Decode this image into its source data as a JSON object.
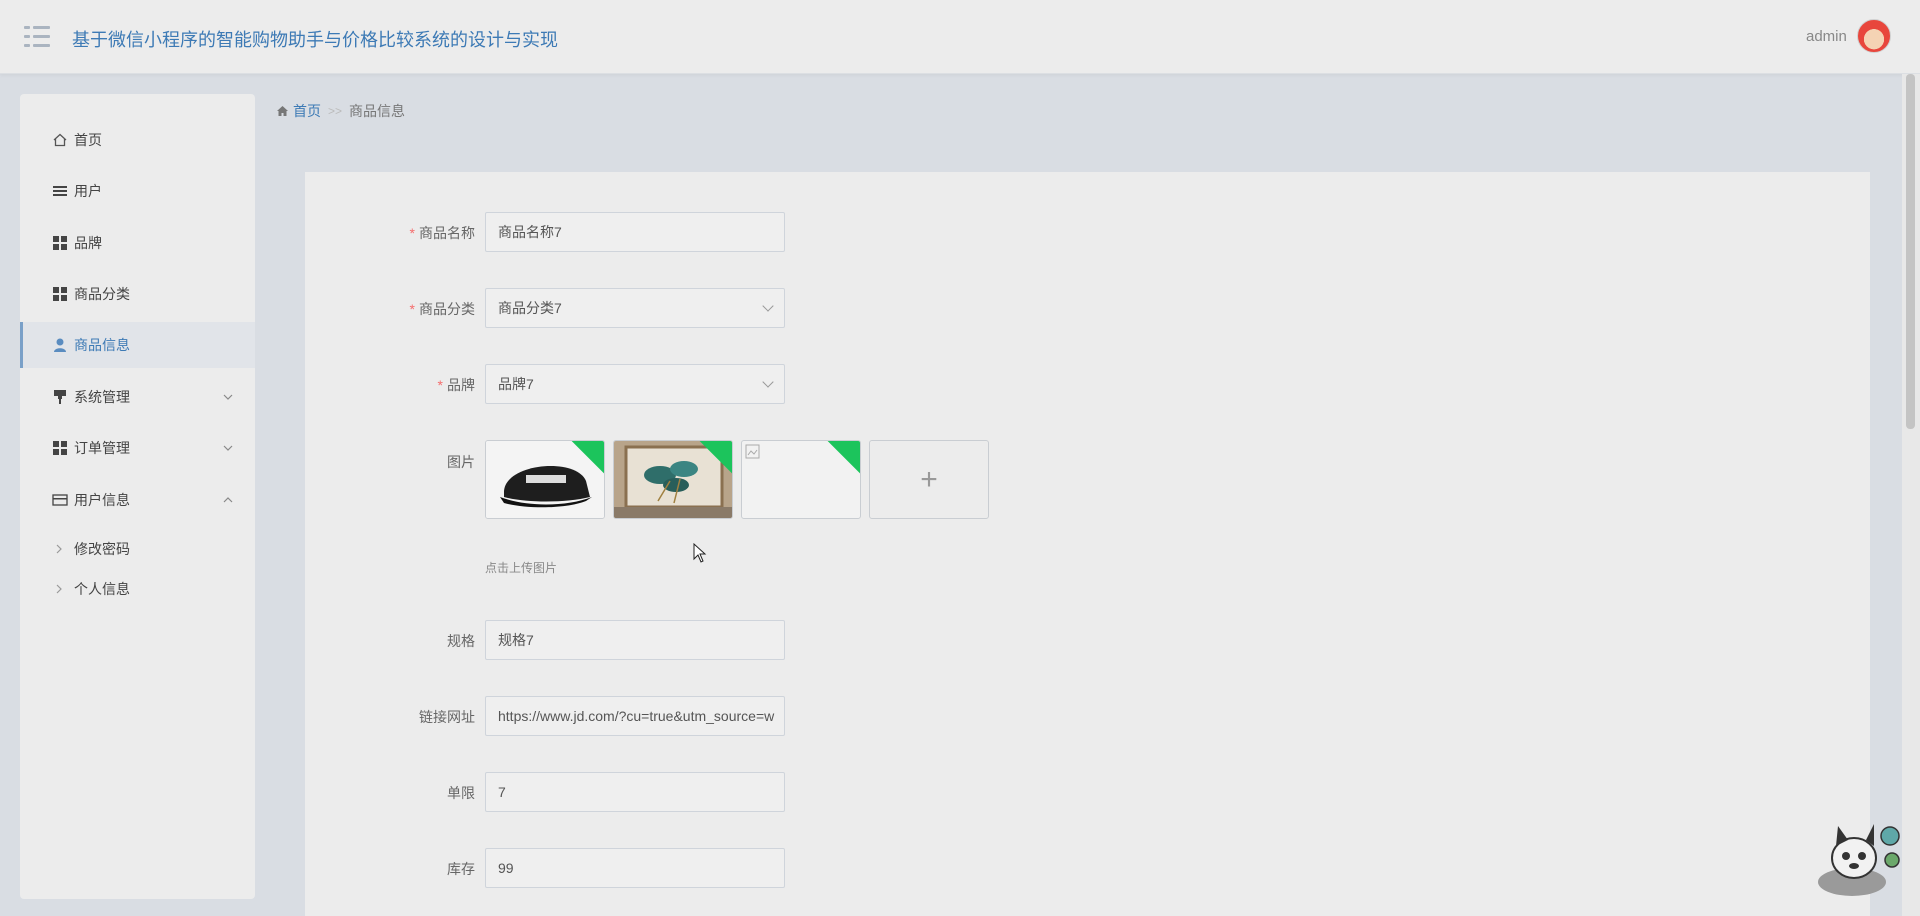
{
  "header": {
    "title": "基于微信小程序的智能购物助手与价格比较系统的设计与实现",
    "user": "admin"
  },
  "sidebar": {
    "items": [
      {
        "label": "首页",
        "icon": "home-icon"
      },
      {
        "label": "用户",
        "icon": "list-icon"
      },
      {
        "label": "品牌",
        "icon": "grid-icon"
      },
      {
        "label": "商品分类",
        "icon": "grid-icon"
      },
      {
        "label": "商品信息",
        "icon": "person-icon",
        "active": true
      },
      {
        "label": "系统管理",
        "icon": "brush-icon",
        "expandable": true
      },
      {
        "label": "订单管理",
        "icon": "grid-icon",
        "expandable": true
      },
      {
        "label": "用户信息",
        "icon": "card-icon",
        "expanded": true
      }
    ],
    "subitems": [
      "修改密码",
      "个人信息"
    ]
  },
  "breadcrumb": {
    "home": "首页",
    "separator": ">>",
    "current": "商品信息"
  },
  "form": {
    "name": {
      "label": "商品名称",
      "value": "商品名称7",
      "required": true
    },
    "category": {
      "label": "商品分类",
      "value": "商品分类7",
      "required": true
    },
    "brand": {
      "label": "品牌",
      "value": "品牌7",
      "required": true
    },
    "images": {
      "label": "图片",
      "hint": "点击上传图片",
      "plus": "+"
    },
    "spec": {
      "label": "规格",
      "value": "规格7"
    },
    "link": {
      "label": "链接网址",
      "value": "https://www.jd.com/?cu=true&utm_source=w"
    },
    "limit": {
      "label": "单限",
      "value": "7"
    },
    "stock": {
      "label": "库存",
      "value": "99"
    }
  },
  "colors": {
    "accent": "#3d7ab5",
    "required": "#f56c6c",
    "badge": "#1cc45c"
  }
}
